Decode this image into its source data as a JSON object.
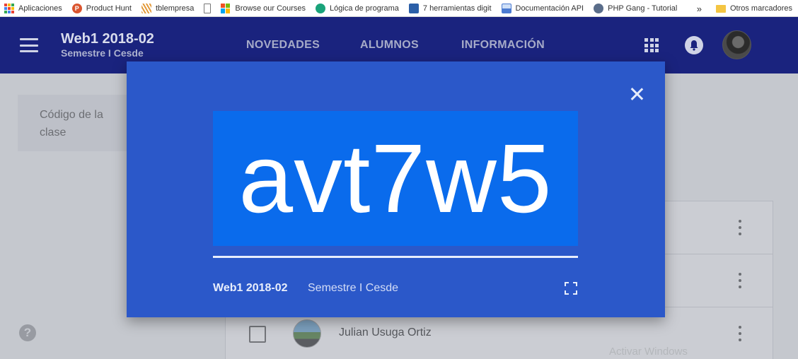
{
  "bookmarks": {
    "items": [
      {
        "label": "Aplicaciones",
        "icon": "apps-grid-icon"
      },
      {
        "label": "Product Hunt",
        "icon": "product-hunt-icon",
        "color": "#da552f"
      },
      {
        "label": "tblempresa",
        "icon": "stripes-icon",
        "color": "#e39b3c"
      },
      {
        "label": "",
        "icon": "document-icon"
      },
      {
        "label": "Browse our Courses",
        "icon": "microsoft-icon"
      },
      {
        "label": "Lógica de programa",
        "icon": "globe-icon",
        "color": "#1aa37a"
      },
      {
        "label": "7 herramientas digit",
        "icon": "blog-icon",
        "color": "#2b5fa8"
      },
      {
        "label": "Documentación API",
        "icon": "image-icon",
        "color": "#4c7bd1"
      },
      {
        "label": "PHP Gang - Tutorial",
        "icon": "php-gang-icon",
        "color": "#5a6d8a"
      }
    ],
    "overflow": "»",
    "other": "Otros marcadores"
  },
  "header": {
    "course_title": "Web1 2018-02",
    "course_subtitle": "Semestre I Cesde",
    "tabs": [
      "NOVEDADES",
      "ALUMNOS",
      "INFORMACIÓN"
    ],
    "brand_color": "#1a237e"
  },
  "background": {
    "class_code_label": "Código de la clase",
    "student_name": "Julian Usuga Ortiz",
    "help_symbol": "?",
    "watermark": "Activar Windows"
  },
  "modal": {
    "class_code": "avt7w5",
    "course_title": "Web1 2018-02",
    "course_subtitle": "Semestre I Cesde",
    "background_color": "#2b58c9",
    "code_highlight_color": "#0a6bec"
  }
}
